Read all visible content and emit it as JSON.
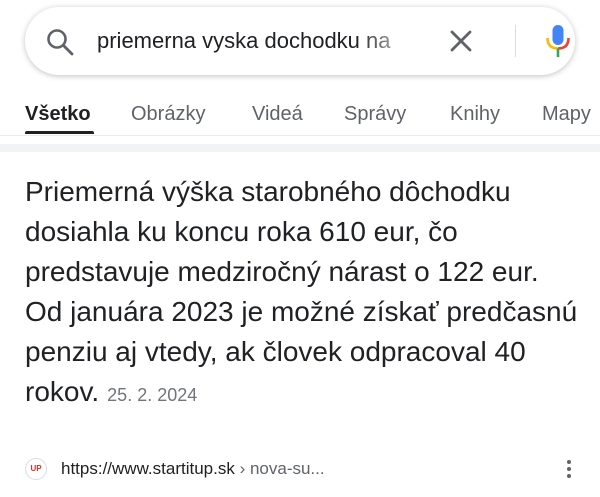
{
  "search": {
    "query": "priemerna vyska dochodku na",
    "icons": {
      "search": "search-icon",
      "clear": "close-icon",
      "mic": "microphone-icon"
    }
  },
  "tabs": [
    {
      "label": "Všetko",
      "active": true
    },
    {
      "label": "Obrázky",
      "active": false
    },
    {
      "label": "Videá",
      "active": false
    },
    {
      "label": "Správy",
      "active": false
    },
    {
      "label": "Knihy",
      "active": false
    },
    {
      "label": "Mapy",
      "active": false
    }
  ],
  "featured_snippet": {
    "text": "Priemerná výška starobného dôchodku dosiahla ku koncu roka 610 eur, čo predstavuje medziročný nárast o 122 eur. Od januára 2023 je možné získať predčasnú penziu aj vtedy, ak človek odpracoval 40 rokov.",
    "date": "25. 2. 2024"
  },
  "source": {
    "favicon_text": "UP",
    "url": "https://www.startitup.sk",
    "path": " › nova-su..."
  },
  "colors": {
    "text": "#202124",
    "secondary": "#5f6368",
    "google_blue": "#4285f4",
    "google_red": "#ea4335",
    "google_yellow": "#fbbc04",
    "google_green": "#34a853"
  }
}
